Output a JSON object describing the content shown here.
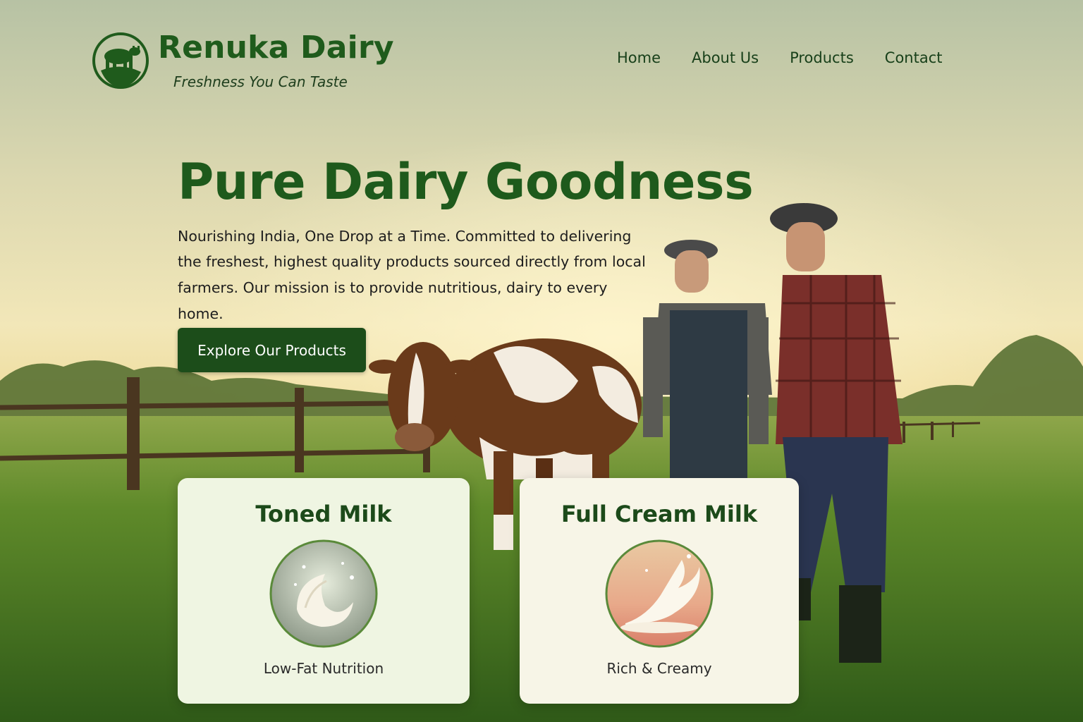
{
  "brand": {
    "name": "Renuka Dairy",
    "tagline": "Freshness You Can Taste",
    "logo_icon": "cow-icon",
    "color": "#1f5b1c"
  },
  "nav": {
    "items": [
      {
        "label": "Home"
      },
      {
        "label": "About Us"
      },
      {
        "label": "Products"
      },
      {
        "label": "Contact"
      }
    ]
  },
  "hero": {
    "title": "Pure Dairy Goodness",
    "description": "Nourishing India, One Drop at a Time. Committed to delivering the freshest, highest quality products sourced directly from local farmers. Our mission is to provide nutritious, dairy to every home.",
    "cta_label": "Explore Our Products",
    "cta_color": "#1c4d1a",
    "background": "farm-sunset-cow-farmers-image"
  },
  "products": [
    {
      "title": "Toned Milk",
      "subtitle": "Low-Fat Nutrition",
      "image": "milk-splash-image"
    },
    {
      "title": "Full Cream Milk",
      "subtitle": "Rich & Creamy",
      "image": "cream-splash-image"
    }
  ]
}
